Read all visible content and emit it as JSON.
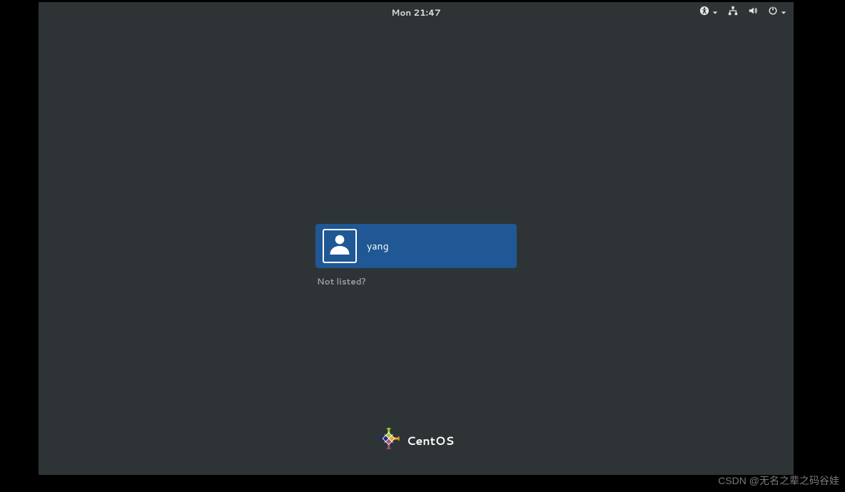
{
  "topbar": {
    "clock": "Mon 21:47"
  },
  "login": {
    "users": [
      {
        "name": "yang"
      }
    ],
    "not_listed_label": "Not listed?"
  },
  "branding": {
    "os_name": "CentOS"
  },
  "watermark": "CSDN @无名之辈之码谷娃"
}
